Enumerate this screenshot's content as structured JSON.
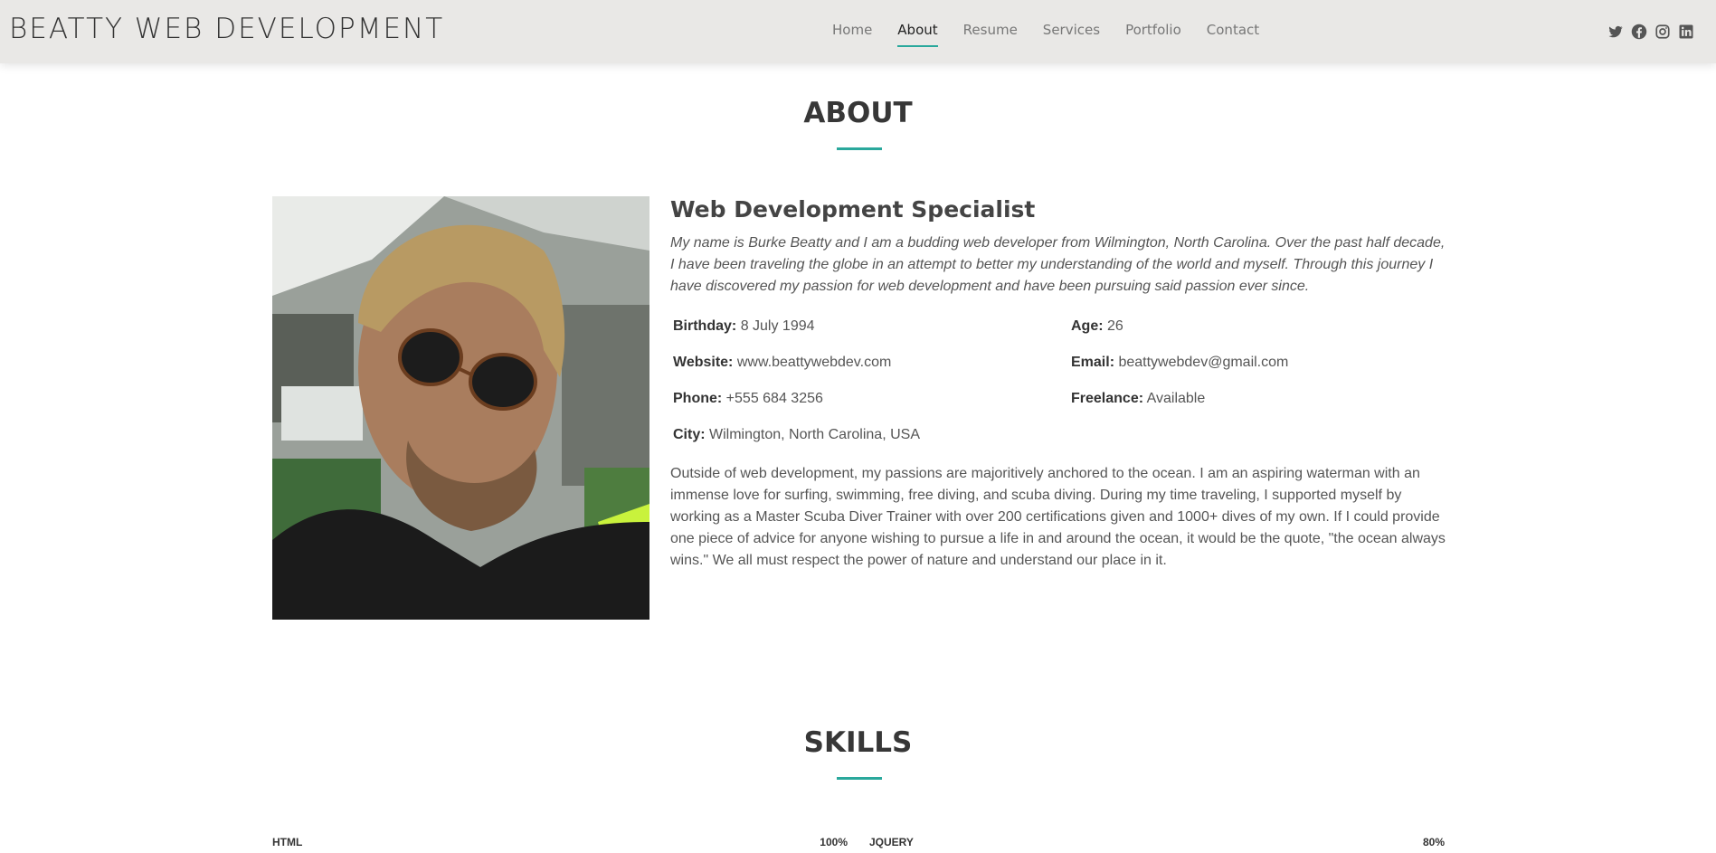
{
  "header": {
    "brand": "BEATTY WEB DEVELOPMENT",
    "nav": [
      {
        "label": "Home",
        "active": false
      },
      {
        "label": "About",
        "active": true
      },
      {
        "label": "Resume",
        "active": false
      },
      {
        "label": "Services",
        "active": false
      },
      {
        "label": "Portfolio",
        "active": false
      },
      {
        "label": "Contact",
        "active": false
      }
    ],
    "socials": [
      "twitter-icon",
      "facebook-icon",
      "instagram-icon",
      "linkedin-icon"
    ]
  },
  "about": {
    "title": "ABOUT",
    "subtitle": "Web Development Specialist",
    "intro": "My name is Burke Beatty and I am a budding web developer from Wilmington, North Carolina. Over the past half decade, I have been traveling the globe in an attempt to better my understanding of the world and myself. Through this journey I have discovered my passion for web development and have been pursuing said passion ever since.",
    "info_left": [
      {
        "label": "Birthday:",
        "value": "8 July 1994"
      },
      {
        "label": "Website:",
        "value": "www.beattywebdev.com"
      },
      {
        "label": "Phone:",
        "value": "+555 684 3256"
      },
      {
        "label": "City:",
        "value": "Wilmington, North Carolina, USA"
      }
    ],
    "info_right": [
      {
        "label": "Age:",
        "value": "26"
      },
      {
        "label": "Email:",
        "value": "beattywebdev@gmail.com"
      },
      {
        "label": "Freelance:",
        "value": "Available"
      }
    ],
    "paragraph": "Outside of web development, my passions are majoritively anchored to the ocean. I am an aspiring waterman with an immense love for surfing, swimming, free diving, and scuba diving. During my time traveling, I supported myself by working as a Master Scuba Diver Trainer with over 200 certifications given and 1000+ dives of my own. If I could provide one piece of advice for anyone wishing to pursue a life in and around the ocean, it would be the quote, \"the ocean always wins.\" We all must respect the power of nature and understand our place in it."
  },
  "skills": {
    "title": "SKILLS",
    "items": [
      {
        "name": "HTML",
        "percent": "100%"
      },
      {
        "name": "JQUERY",
        "percent": "80%"
      }
    ]
  },
  "colors": {
    "accent": "#2aa89c",
    "header_bg": "#e9e8e6"
  }
}
